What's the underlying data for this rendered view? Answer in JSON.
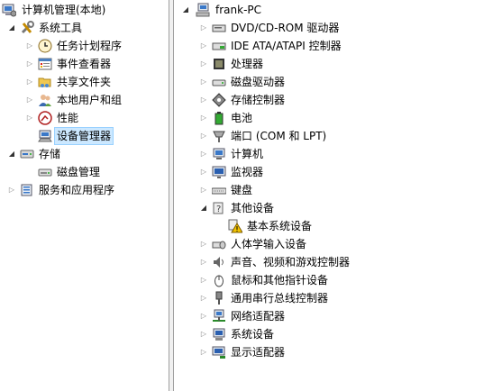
{
  "left_tree": {
    "root": "计算机管理(本地)",
    "system_tools": "系统工具",
    "task_scheduler": "任务计划程序",
    "event_viewer": "事件查看器",
    "shared_folders": "共享文件夹",
    "local_users": "本地用户和组",
    "performance": "性能",
    "device_manager": "设备管理器",
    "storage": "存储",
    "disk_management": "磁盘管理",
    "services_apps": "服务和应用程序"
  },
  "right_tree": {
    "computer": "frank-PC",
    "categories": [
      "DVD/CD-ROM 驱动器",
      "IDE ATA/ATAPI 控制器",
      "处理器",
      "磁盘驱动器",
      "存储控制器",
      "电池",
      "端口 (COM 和 LPT)",
      "计算机",
      "监视器",
      "键盘",
      "其他设备",
      "基本系统设备",
      "人体学输入设备",
      "声音、视频和游戏控制器",
      "鼠标和其他指针设备",
      "通用串行总线控制器",
      "网络适配器",
      "系统设备",
      "显示适配器"
    ]
  },
  "colors": {
    "selection_bg": "#cce8ff",
    "selection_border": "#99d1ff",
    "splitter": "#f0f0f0"
  }
}
